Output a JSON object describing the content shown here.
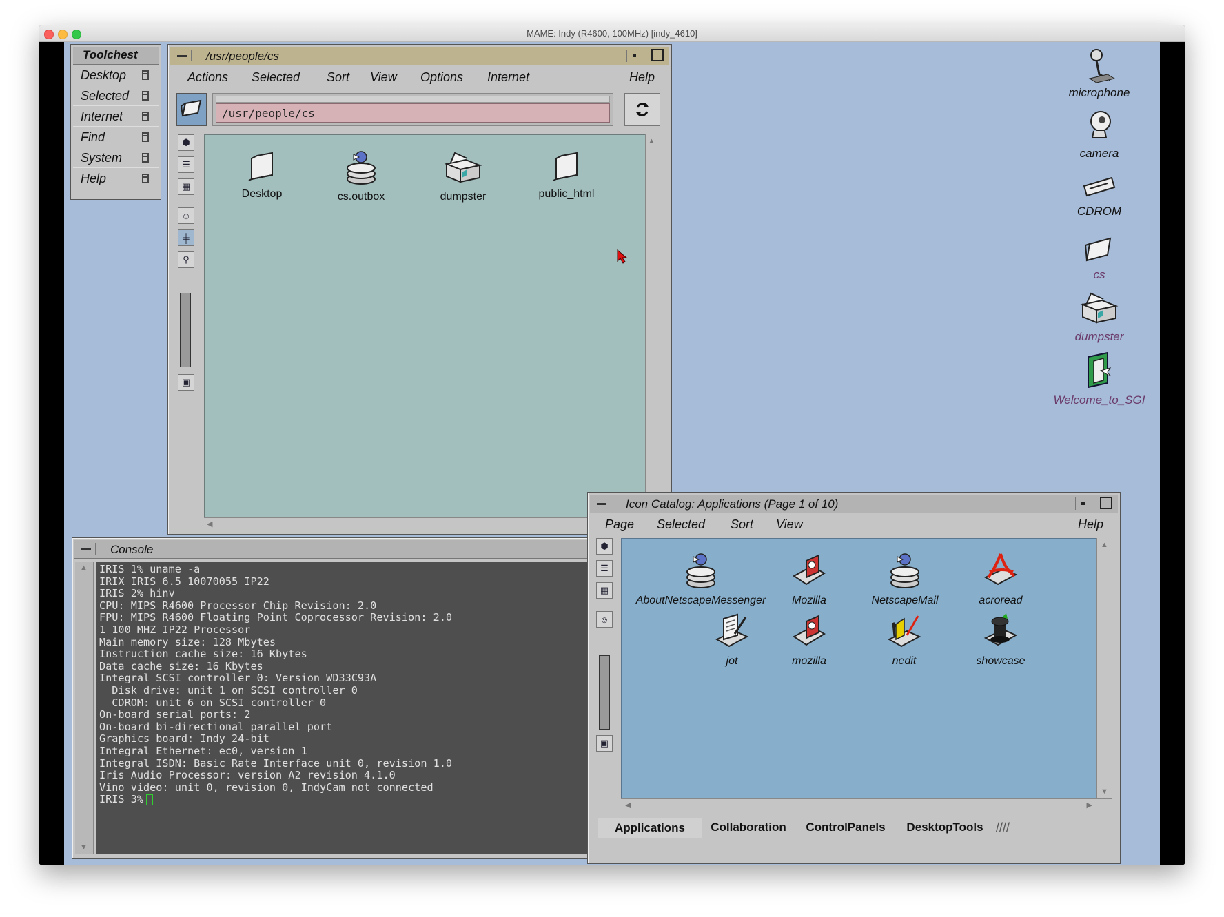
{
  "window": {
    "title": "MAME: Indy (R4600, 100MHz) [indy_4610]"
  },
  "colors": {
    "desktop": "#a7bcd8",
    "file_view": "#a2bebd",
    "catalog_view": "#87aecb",
    "titlebar_active": "#bdb38f",
    "console_bg": "#4e4e4e",
    "path_field": "#d6b2b7"
  },
  "toolchest": {
    "title": "Toolchest",
    "items": [
      "Desktop",
      "Selected",
      "Internet",
      "Find",
      "System",
      "Help"
    ]
  },
  "file_manager": {
    "title": "/usr/people/cs",
    "menu": [
      "Actions",
      "Selected",
      "Sort",
      "View",
      "Options",
      "Internet",
      "Help"
    ],
    "path": "/usr/people/cs",
    "icons": [
      {
        "label": "Desktop",
        "icon": "folder-icon"
      },
      {
        "label": "cs.outbox",
        "icon": "mailbox-icon"
      },
      {
        "label": "dumpster",
        "icon": "dumpster-icon"
      },
      {
        "label": "public_html",
        "icon": "folder-icon"
      }
    ]
  },
  "console": {
    "title": "Console",
    "lines": [
      "IRIS 1% uname -a",
      "IRIX IRIS 6.5 10070055 IP22",
      "IRIS 2% hinv",
      "CPU: MIPS R4600 Processor Chip Revision: 2.0",
      "FPU: MIPS R4600 Floating Point Coprocessor Revision: 2.0",
      "1 100 MHZ IP22 Processor",
      "Main memory size: 128 Mbytes",
      "Instruction cache size: 16 Kbytes",
      "Data cache size: 16 Kbytes",
      "Integral SCSI controller 0: Version WD33C93A",
      "  Disk drive: unit 1 on SCSI controller 0",
      "  CDROM: unit 6 on SCSI controller 0",
      "On-board serial ports: 2",
      "On-board bi-directional parallel port",
      "Graphics board: Indy 24-bit",
      "Integral Ethernet: ec0, version 1",
      "Integral ISDN: Basic Rate Interface unit 0, revision 1.0",
      "Iris Audio Processor: version A2 revision 4.1.0",
      "Vino video: unit 0, revision 0, IndyCam not connected"
    ],
    "prompt": "IRIS 3%"
  },
  "icon_catalog": {
    "title": "Icon Catalog: Applications (Page 1 of 10)",
    "menu": [
      "Page",
      "Selected",
      "Sort",
      "View",
      "Help"
    ],
    "icons": [
      {
        "label": "AboutNetscapeMessenger",
        "icon": "netscape-messenger-icon"
      },
      {
        "label": "Mozilla",
        "icon": "mozilla-icon"
      },
      {
        "label": "NetscapeMail",
        "icon": "netscape-mail-icon"
      },
      {
        "label": "acroread",
        "icon": "acrobat-icon"
      },
      {
        "label": "jot",
        "icon": "notepad-icon"
      },
      {
        "label": "mozilla",
        "icon": "mozilla-icon"
      },
      {
        "label": "nedit",
        "icon": "text-editor-icon"
      },
      {
        "label": "showcase",
        "icon": "showcase-icon"
      }
    ],
    "tabs": [
      "Applications",
      "Collaboration",
      "ControlPanels",
      "DesktopTools"
    ],
    "active_tab": "Applications"
  },
  "desktop_icons": [
    {
      "label": "microphone",
      "icon": "microphone-icon"
    },
    {
      "label": "camera",
      "icon": "camera-icon"
    },
    {
      "label": "CDROM",
      "icon": "cdrom-icon"
    },
    {
      "label": "cs",
      "icon": "home-folder-icon"
    },
    {
      "label": "dumpster",
      "icon": "dumpster-icon"
    },
    {
      "label": "Welcome_to_SGI",
      "icon": "welcome-sgi-icon"
    }
  ]
}
